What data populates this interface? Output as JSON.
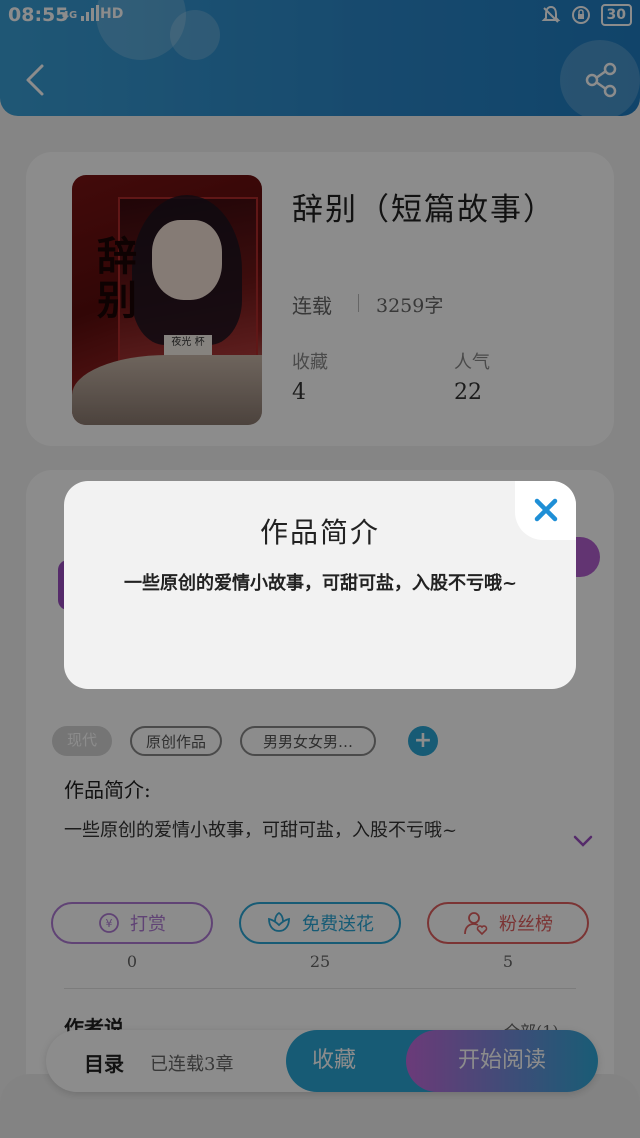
{
  "status_bar": {
    "time": "08:55",
    "network": "4G",
    "hd": "HD",
    "battery": "30"
  },
  "header": {
    "back_icon": "chevron-left-icon",
    "share_icon": "share-icon"
  },
  "book": {
    "cover_title": "辞别",
    "cover_tag": "夜光 杯",
    "title": "辞别（短篇故事）",
    "status": "连载",
    "word_count": "3259字",
    "stats": [
      {
        "label": "收藏",
        "value": "4"
      },
      {
        "label": "人气",
        "value": "22"
      }
    ]
  },
  "tags": {
    "items": [
      "现代",
      "原创作品",
      "男男女女男…"
    ],
    "add_icon": "plus-icon"
  },
  "intro": {
    "heading": "作品简介:",
    "text": "一些原创的爱情小故事，可甜可盐，入股不亏哦~",
    "expand_icon": "chevron-down-icon"
  },
  "actions": [
    {
      "label": "打赏",
      "icon": "yuan-icon",
      "count": "0",
      "color": "#b07ad6"
    },
    {
      "label": "免费送花",
      "icon": "flower-icon",
      "count": "25",
      "color": "#2aa7d6"
    },
    {
      "label": "粉丝榜",
      "icon": "user-heart-icon",
      "count": "5",
      "color": "#e06060"
    }
  ],
  "author": {
    "heading": "作者说",
    "all_link": "全部(1)"
  },
  "bottom_bar": {
    "toc_label": "目录",
    "toc_count": "已连载3章",
    "collect": "收藏",
    "read": "开始阅读"
  },
  "modal": {
    "title": "作品简介",
    "body": "一些原创的爱情小故事，可甜可盐，入股不亏哦~",
    "close_icon": "close-icon",
    "close_color": "#1f8fd6"
  }
}
